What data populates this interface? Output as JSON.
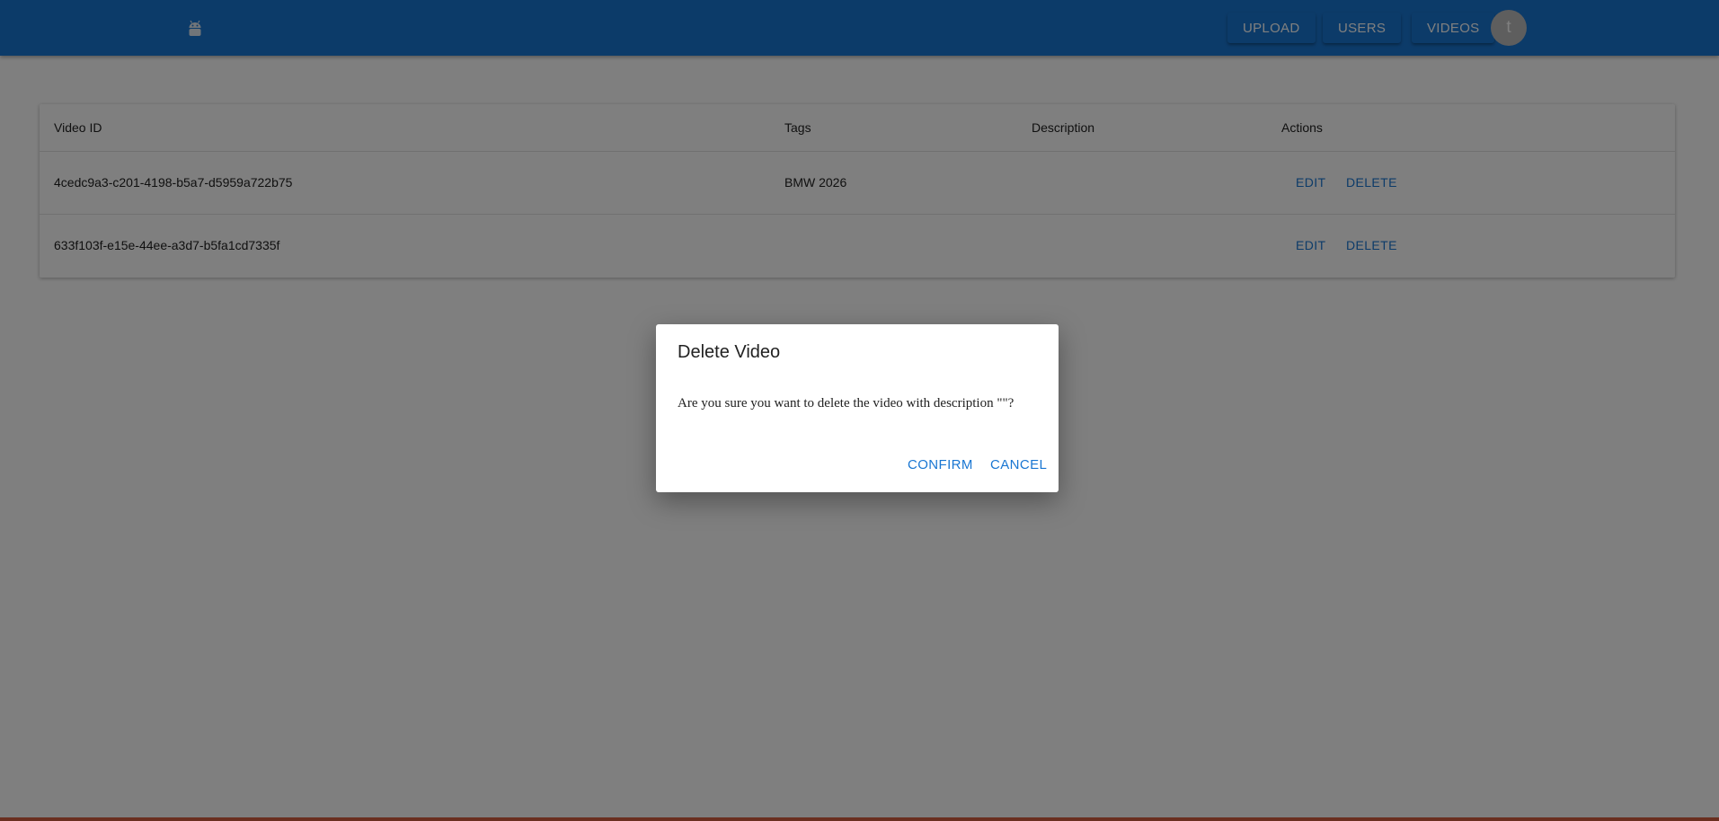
{
  "appbar": {
    "logo_icon": "android-icon",
    "nav": [
      "UPLOAD",
      "USERS",
      "VIDEOS"
    ],
    "avatar_letter": "t"
  },
  "table": {
    "headers": [
      "Video ID",
      "Tags",
      "Description",
      "Actions"
    ],
    "rows": [
      {
        "id": "4cedc9a3-c201-4198-b5a7-d5959a722b75",
        "tags": "BMW 2026",
        "description": "",
        "edit": "EDIT",
        "delete": "DELETE"
      },
      {
        "id": "633f103f-e15e-44ee-a3d7-b5fa1cd7335f",
        "tags": "",
        "description": "",
        "edit": "EDIT",
        "delete": "DELETE"
      }
    ]
  },
  "dialog": {
    "title": "Delete Video",
    "message": "Are you sure you want to delete the video with description \"\"?",
    "confirm": "CONFIRM",
    "cancel": "CANCEL"
  },
  "colors": {
    "primary": "#1976d2",
    "overlay": "rgba(0,0,0,0.5)"
  }
}
